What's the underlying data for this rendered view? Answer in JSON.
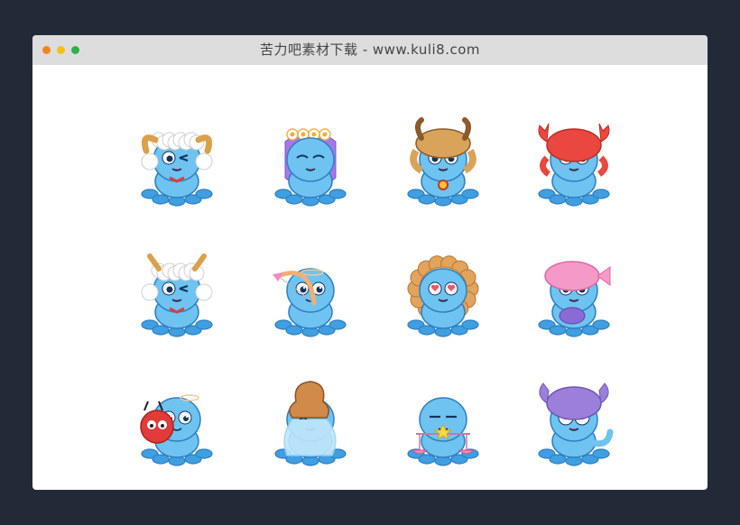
{
  "window": {
    "title": "苦力吧素材下载 - www.kuli8.com",
    "controls": [
      "close",
      "minimize",
      "maximize"
    ]
  },
  "stickers": [
    {
      "name": "aries-octopus",
      "hat": "ram-fleece",
      "hat_color": "#ffffff",
      "accent": "#d9a14c",
      "eyes": "wink"
    },
    {
      "name": "virgo-octopus",
      "hat": "flower-crown",
      "hat_color": "#a678e6",
      "accent": "#f4a93b",
      "eyes": "closed"
    },
    {
      "name": "taurus-octopus",
      "hat": "bull",
      "hat_color": "#d9a35a",
      "accent": "#8a5a2b",
      "eyes": "dizzy"
    },
    {
      "name": "cancer-octopus",
      "hat": "crab",
      "hat_color": "#e9473f",
      "accent": "#ffffff",
      "eyes": "normal"
    },
    {
      "name": "capricorn-octopus",
      "hat": "goat-fleece",
      "hat_color": "#ffffff",
      "accent": "#d9a14c",
      "eyes": "wink"
    },
    {
      "name": "sagittarius-octopus",
      "hat": "bow-arrow",
      "hat_color": "#f0b070",
      "accent": "#f48ac0",
      "eyes": "focused"
    },
    {
      "name": "leo-octopus",
      "hat": "lion-mane",
      "hat_color": "#e2a35d",
      "accent": "#f7d27a",
      "eyes": "hearts"
    },
    {
      "name": "pisces-octopus",
      "hat": "fish",
      "hat_color": "#f59ac8",
      "accent": "#8a6ad6",
      "eyes": "dizzy"
    },
    {
      "name": "gemini-octopus",
      "hat": "red-twin",
      "hat_color": "#e23b3b",
      "accent": "#7aa8e0",
      "eyes": "sad"
    },
    {
      "name": "aquarius-octopus",
      "hat": "water-jar",
      "hat_color": "#d08a4a",
      "accent": "#9ad3f5",
      "eyes": "hidden"
    },
    {
      "name": "libra-octopus",
      "hat": "scales",
      "hat_color": "#f08ab5",
      "accent": "#ffd54a",
      "eyes": "sleepy"
    },
    {
      "name": "scorpio-octopus",
      "hat": "scorpion",
      "hat_color": "#9b7fd8",
      "accent": "#6d55b5",
      "eyes": "shocked"
    }
  ]
}
